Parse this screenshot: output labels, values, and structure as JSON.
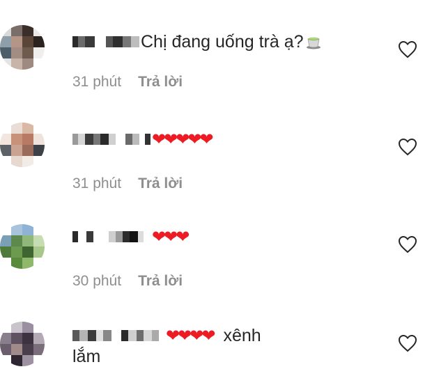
{
  "comments": [
    {
      "text": "Chị đang uống trà ạ?",
      "emoji_icon": "tea-cup-icon",
      "time": "31 phút",
      "reply_label": "Trả lời"
    },
    {
      "text": "",
      "hearts": "❤❤❤❤❤",
      "time": "31 phút",
      "reply_label": "Trả lời"
    },
    {
      "text": "",
      "hearts": "❤❤❤",
      "time": "30 phút",
      "reply_label": "Trả lời"
    },
    {
      "text": "xênh",
      "text_continued": "lắm",
      "hearts": "❤❤❤❤"
    }
  ],
  "colors": {
    "text": "#262626",
    "meta": "#8e8e8e",
    "heart": "#ed1c24"
  }
}
